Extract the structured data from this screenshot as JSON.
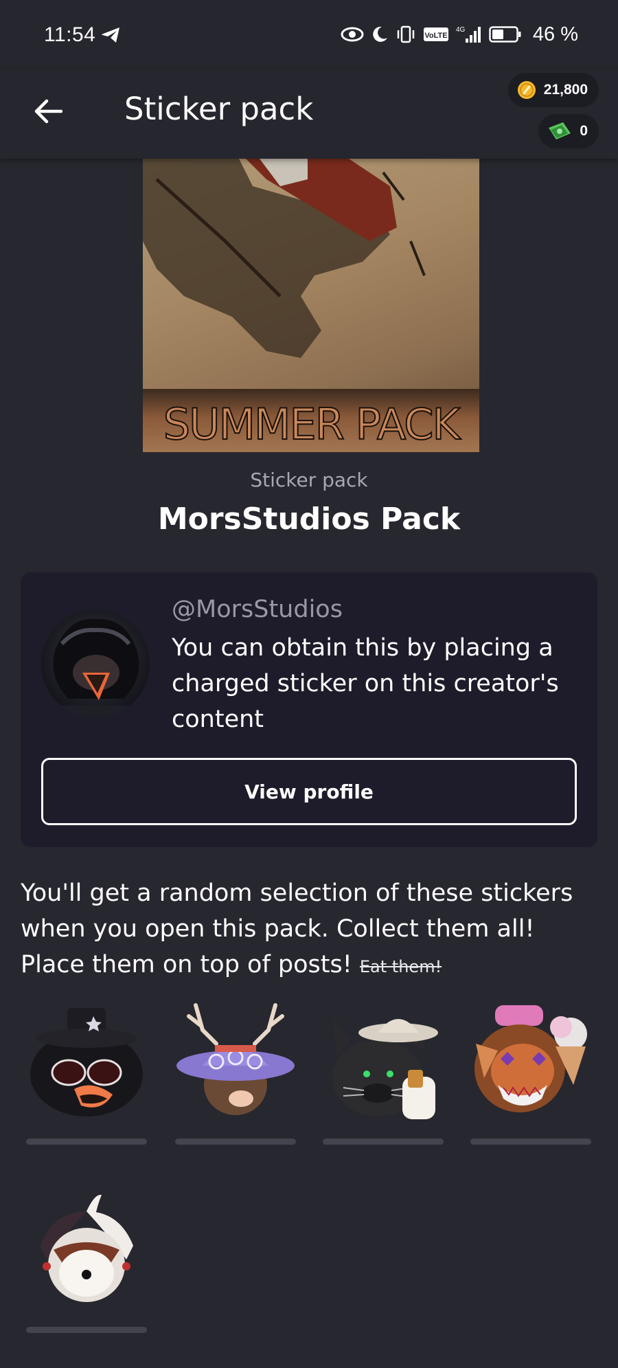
{
  "status_bar": {
    "time": "11:54",
    "battery": "46 %",
    "volte": "VoLTE",
    "network": "4G"
  },
  "app_bar": {
    "title": "Sticker pack",
    "coins": "21,800",
    "cash": "0"
  },
  "cover": {
    "title": "SUMMER PACK"
  },
  "pack": {
    "subtitle": "Sticker pack",
    "name": "MorsStudios Pack"
  },
  "creator": {
    "handle": "@MorsStudios",
    "description": "You can obtain this by placing a charged sticker on this creator's content",
    "button_label": "View profile"
  },
  "info": {
    "text": "You'll get a random selection of these stickers when you open this pack. Collect them all! Place them on top of posts! ",
    "strike": "Eat them!"
  },
  "stickers": [
    {
      "icon": "crow-sunglasses-sticker"
    },
    {
      "icon": "antler-hat-sticker"
    },
    {
      "icon": "cowboy-cat-sticker"
    },
    {
      "icon": "lion-icecream-sticker"
    },
    {
      "icon": "jester-sticker"
    }
  ],
  "colors": {
    "background": "#27272f",
    "card": "#1e1c2a",
    "muted_text": "#a8a8b4",
    "coin": "#f5b82e",
    "cash": "#5ac35a"
  }
}
